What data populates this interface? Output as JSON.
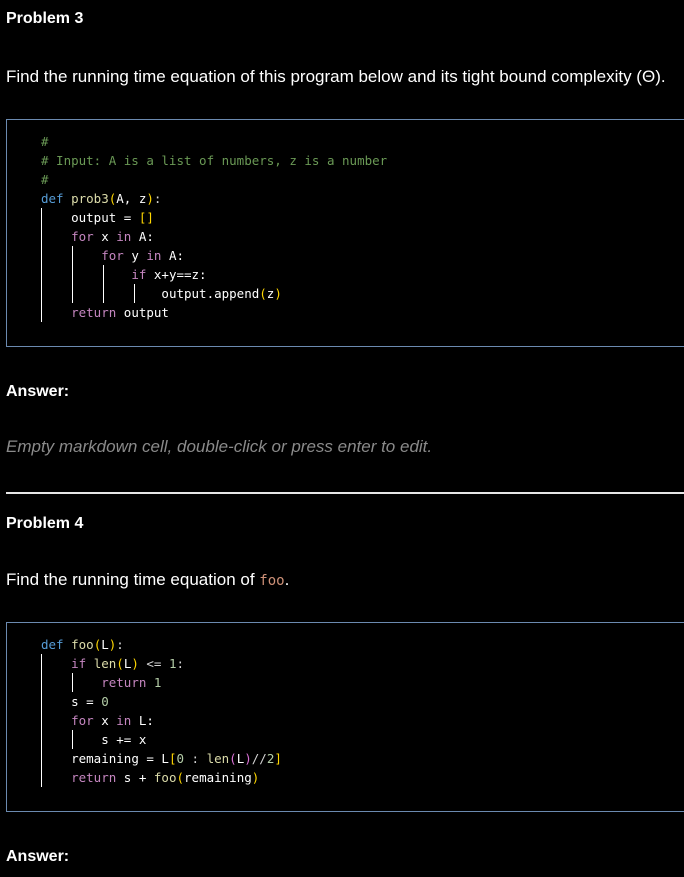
{
  "problem3": {
    "title": "Problem 3",
    "description": "Find the running time equation of this program below and its tight bound complexity (Θ).",
    "code": {
      "line1": "#",
      "line2": "# Input: A is a list of numbers, z is a number",
      "line3": "#",
      "def_kw": "def",
      "fn_name": "prob3",
      "params": "A, z",
      "output_assign": "output = ",
      "empty_list": "[]",
      "for_kw": "for",
      "x_var": "x",
      "in_kw": "in",
      "list_a": "A:",
      "y_var": "y",
      "if_kw": "if",
      "cond": "x+y==z:",
      "append_call": "output.append",
      "append_arg": "z",
      "return_kw": "return",
      "return_val": "output"
    },
    "answer_label": "Answer:",
    "empty_cell": "Empty markdown cell, double-click or press enter to edit."
  },
  "problem4": {
    "title": "Problem 4",
    "description_prefix": "Find the running time equation of ",
    "description_code": "foo",
    "description_suffix": ".",
    "code": {
      "def_kw": "def",
      "fn_name": "foo",
      "param": "L",
      "if_kw": "if",
      "len_fn": "len",
      "cmp": " <= ",
      "one": "1",
      "return_kw": "return",
      "s_assign": "s = ",
      "zero": "0",
      "for_kw": "for",
      "x_var": "x",
      "in_kw": "in",
      "list_l": "L:",
      "s_inc": "s += x",
      "remaining_assign": "remaining = L",
      "slice_open": "[",
      "slice_zero": "0",
      "slice_colon": " : ",
      "half_div": "//",
      "two": "2",
      "slice_close": "]",
      "return_expr_a": "s + ",
      "foo_call": "foo",
      "remaining_arg": "remaining"
    },
    "answer_label": "Answer:"
  }
}
